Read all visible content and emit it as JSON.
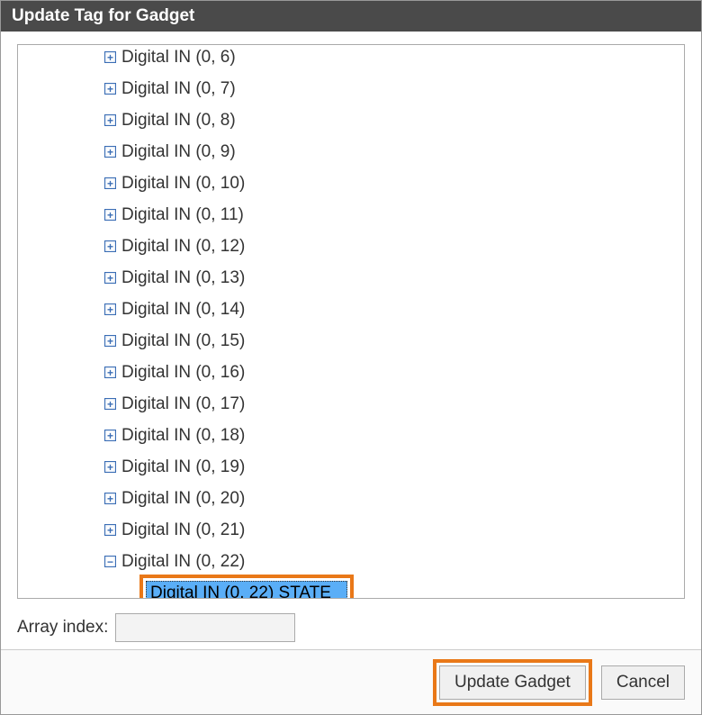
{
  "dialog": {
    "title": "Update Tag for Gadget"
  },
  "tree": {
    "nodes": [
      {
        "label": "Digital IN (0, 6)",
        "expanded": false
      },
      {
        "label": "Digital IN (0, 7)",
        "expanded": false
      },
      {
        "label": "Digital IN (0, 8)",
        "expanded": false
      },
      {
        "label": "Digital IN (0, 9)",
        "expanded": false
      },
      {
        "label": "Digital IN (0, 10)",
        "expanded": false
      },
      {
        "label": "Digital IN (0, 11)",
        "expanded": false
      },
      {
        "label": "Digital IN (0, 12)",
        "expanded": false
      },
      {
        "label": "Digital IN (0, 13)",
        "expanded": false
      },
      {
        "label": "Digital IN (0, 14)",
        "expanded": false
      },
      {
        "label": "Digital IN (0, 15)",
        "expanded": false
      },
      {
        "label": "Digital IN (0, 16)",
        "expanded": false
      },
      {
        "label": "Digital IN (0, 17)",
        "expanded": false
      },
      {
        "label": "Digital IN (0, 18)",
        "expanded": false
      },
      {
        "label": "Digital IN (0, 19)",
        "expanded": false
      },
      {
        "label": "Digital IN (0, 20)",
        "expanded": false
      },
      {
        "label": "Digital IN (0, 21)",
        "expanded": false
      },
      {
        "label": "Digital IN (0, 22)",
        "expanded": true,
        "child": {
          "label": "Digital IN (0, 22) STATE",
          "selected": true
        }
      }
    ]
  },
  "arrayIndex": {
    "label": "Array index:",
    "value": ""
  },
  "buttons": {
    "update": "Update Gadget",
    "cancel": "Cancel"
  },
  "glyphs": {
    "plus": "+",
    "minus": "−"
  },
  "highlight_color": "#e97818"
}
